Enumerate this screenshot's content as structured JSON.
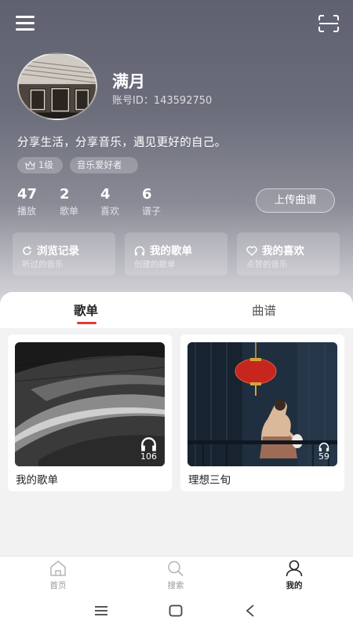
{
  "profile": {
    "name": "满月",
    "account_id": "账号ID：143592750",
    "bio": "分享生活，分享音乐，遇见更好的自己。",
    "tags": {
      "level": "1级",
      "music_lover": "音乐爱好者"
    },
    "stats": [
      {
        "value": "47",
        "label": "播放"
      },
      {
        "value": "2",
        "label": "歌单"
      },
      {
        "value": "4",
        "label": "喜欢"
      },
      {
        "value": "6",
        "label": "谱子"
      }
    ],
    "upload_label": "上传曲谱"
  },
  "quick_cards": [
    {
      "title": "浏览记录",
      "subtitle": "听过的音乐",
      "icon": "refresh-icon"
    },
    {
      "title": "我的歌单",
      "subtitle": "创建的歌单",
      "icon": "headphones-icon"
    },
    {
      "title": "我的喜欢",
      "subtitle": "点赞的音乐",
      "icon": "heart-icon"
    }
  ],
  "tabs": [
    {
      "label": "歌单",
      "active": true
    },
    {
      "label": "曲谱",
      "active": false
    }
  ],
  "playlists": [
    {
      "name": "我的歌单",
      "play_count": "106",
      "cover": "architecture-photo"
    },
    {
      "name": "理想三旬",
      "play_count": "59",
      "cover": "lantern-woman-photo"
    }
  ],
  "bottom_nav": [
    {
      "label": "首页",
      "icon": "home-icon",
      "active": false
    },
    {
      "label": "搜索",
      "icon": "search-icon",
      "active": false
    },
    {
      "label": "我的",
      "icon": "user-icon",
      "active": true
    }
  ],
  "colors": {
    "accent": "#e03a3a",
    "header": "#5f6170"
  }
}
